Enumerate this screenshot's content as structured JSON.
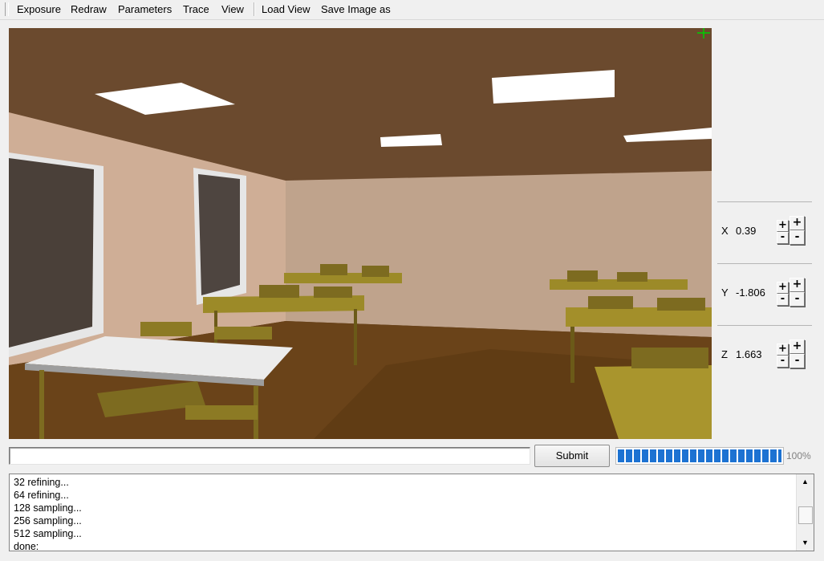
{
  "menu": {
    "exposure": "Exposure",
    "redraw": "Redraw",
    "parameters": "Parameters",
    "trace": "Trace",
    "view": "View",
    "load_view": "Load View",
    "save_image": "Save Image as"
  },
  "coords": {
    "x": {
      "label": "X",
      "value": "0.39"
    },
    "y": {
      "label": "Y",
      "value": "-1.806"
    },
    "z": {
      "label": "Z",
      "value": "1.663"
    }
  },
  "stepper": {
    "plus": "+",
    "minus": "-"
  },
  "command": {
    "value": "",
    "submit_label": "Submit"
  },
  "progress": {
    "percent": 100,
    "text": "100%"
  },
  "log": {
    "lines": [
      "32 refining...",
      "64 refining...",
      "128 sampling...",
      "256 sampling...",
      "512 sampling...",
      "done:"
    ]
  },
  "icons": {
    "scroll_up": "up-arrow-icon",
    "scroll_down": "down-arrow-icon",
    "crosshair": "crosshair-icon"
  },
  "colors": {
    "progress_fill": "#1c72d2",
    "crosshair": "#00d000"
  }
}
